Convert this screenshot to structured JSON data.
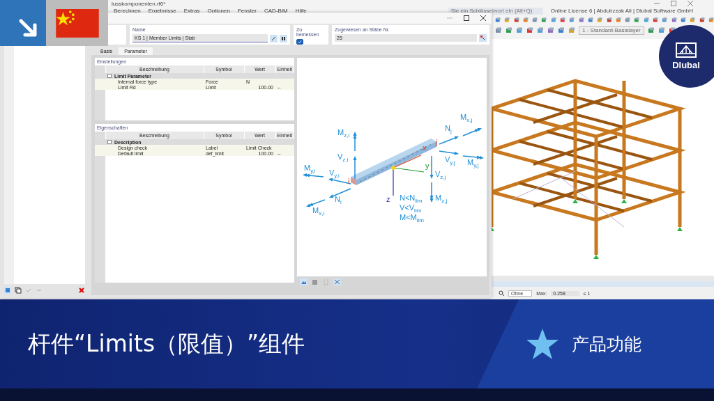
{
  "app": {
    "file_title": "lusskomponenten.rf6*",
    "menu": [
      "Berechnen",
      "Ergebnisse",
      "Extras",
      "Optionen",
      "Fenster",
      "CAD-BIM",
      "Hilfe"
    ],
    "search_placeholder": "Sie ein Schlüsselwort ein (Alt+Q)",
    "license": "Online License 6 | Abdulrzzak Ali | Dlubal Software GmbH",
    "layer": "1 - Standard-Basislayer"
  },
  "dialog": {
    "name_label": "Name",
    "name_value": "KS 1 | Member Limits | Stab",
    "design_label": "Zu bemessen",
    "design_checked": true,
    "assigned_label": "Zugewiesen an Stäbe Nr.",
    "assigned_value": "25",
    "tabs": [
      {
        "label": "Basis",
        "selected": false
      },
      {
        "label": "Parameter",
        "selected": true
      }
    ],
    "sections": [
      {
        "title": "Einstellungen",
        "columns": [
          "Beschreibung",
          "Symbol",
          "Wert",
          "Einheit"
        ],
        "group": "Limit Parameter",
        "rows": [
          {
            "description": "Internal force type",
            "symbol": "Force",
            "value": "N",
            "kind": "text"
          },
          {
            "description": "Limit Rd",
            "symbol": "Limit",
            "value": "100.00",
            "unit": "--",
            "kind": "number"
          }
        ]
      },
      {
        "title": "Eigenschaften",
        "columns": [
          "Beschreibung",
          "Symbol",
          "Wert",
          "Einheit"
        ],
        "group": "Description",
        "rows": [
          {
            "description": "Design check",
            "symbol": "Label",
            "value": "Limit Check",
            "kind": "text"
          },
          {
            "description": "Default limit",
            "symbol": "def_limit",
            "value": "100.00",
            "unit": "--",
            "kind": "number"
          }
        ]
      }
    ]
  },
  "diagram": {
    "labels": [
      {
        "text": "M$_{x,j}$",
        "kind": "force"
      },
      {
        "text": "N$_{j}$",
        "kind": "force"
      },
      {
        "text": "M$_{z,i}$",
        "kind": "force"
      },
      {
        "text": "j",
        "kind": "node"
      },
      {
        "text": "x",
        "kind": "axis-x"
      },
      {
        "text": "V$_{z,i}$",
        "kind": "force"
      },
      {
        "text": "V$_{y,j}$",
        "kind": "force"
      },
      {
        "text": "M$_{y,i}$",
        "kind": "force"
      },
      {
        "text": "V$_{y,i}$",
        "kind": "force"
      },
      {
        "text": "y",
        "kind": "axis-y"
      },
      {
        "text": "M$_{y,j}$",
        "kind": "force"
      },
      {
        "text": "V$_{z,j}$",
        "kind": "force"
      },
      {
        "text": "i",
        "kind": "node"
      },
      {
        "text": "N$_{i}$",
        "kind": "force"
      },
      {
        "text": "z",
        "kind": "axis-z"
      },
      {
        "text": "N<N$_{lim}$",
        "kind": "force"
      },
      {
        "text": "M$_{z,j}$",
        "kind": "force"
      },
      {
        "text": "M$_{x,i}$",
        "kind": "force"
      },
      {
        "text": "V<V$_{lim}$",
        "kind": "force"
      },
      {
        "text": "M<M$_{lim}$",
        "kind": "force"
      }
    ]
  },
  "status": {
    "filter": "Ohne",
    "max_label": "Max:",
    "max_value": "0.258",
    "ratio": "≤ 1"
  },
  "logo": "Dlubal",
  "banner": {
    "title": "杆件“Limits（限值）”组件",
    "tag": "产品功能"
  }
}
